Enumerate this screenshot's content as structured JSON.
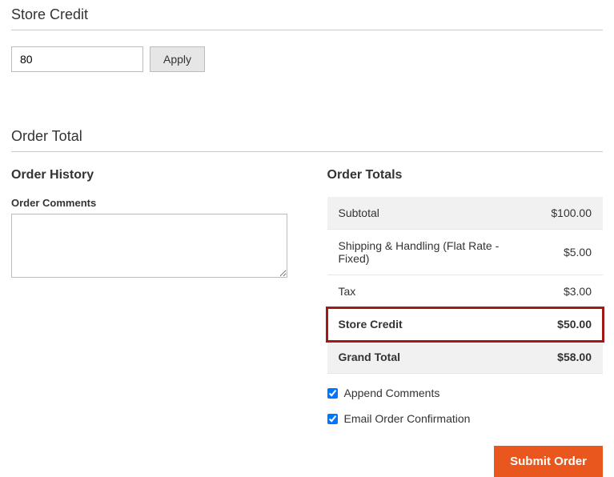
{
  "store_credit": {
    "title": "Store Credit",
    "input_value": "80",
    "apply_label": "Apply"
  },
  "order_total": {
    "title": "Order Total"
  },
  "history": {
    "title": "Order History",
    "comments_label": "Order Comments",
    "comments_value": ""
  },
  "totals": {
    "title": "Order Totals",
    "rows": [
      {
        "label": "Subtotal",
        "value": "$100.00",
        "shaded": true
      },
      {
        "label": "Shipping & Handling (Flat Rate - Fixed)",
        "value": "$5.00"
      },
      {
        "label": "Tax",
        "value": "$3.00"
      },
      {
        "label": "Store Credit",
        "value": "$50.00",
        "highlight": true
      },
      {
        "label": "Grand Total",
        "value": "$58.00",
        "grand": true
      }
    ]
  },
  "options": {
    "append": {
      "label": "Append Comments",
      "checked": true
    },
    "email": {
      "label": "Email Order Confirmation",
      "checked": true
    }
  },
  "submit_label": "Submit Order"
}
